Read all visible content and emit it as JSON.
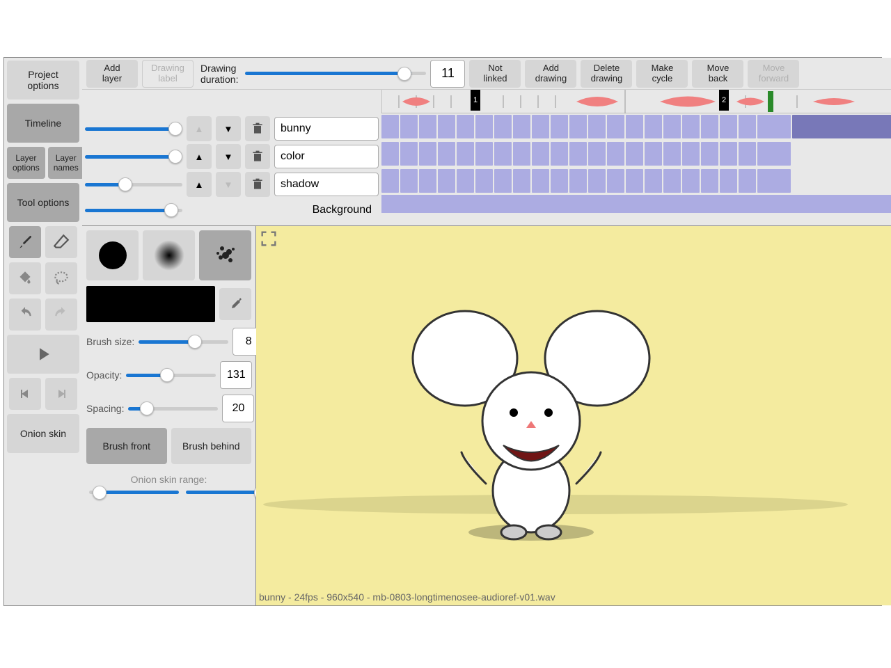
{
  "sidebar": {
    "project_options": "Project\noptions",
    "timeline": "Timeline",
    "layer_options": "Layer\noptions",
    "layer_names": "Layer\nnames",
    "tool_options": "Tool options",
    "onion_skin": "Onion skin"
  },
  "topbar": {
    "add_layer": "Add\nlayer",
    "drawing_label": "Drawing\nlabel",
    "duration_label": "Drawing\nduration:",
    "duration_value": "11",
    "not_linked": "Not\nlinked",
    "add_drawing": "Add\ndrawing",
    "delete_drawing": "Delete\ndrawing",
    "make_cycle": "Make\ncycle",
    "move_back": "Move\nback",
    "move_forward": "Move\nforward"
  },
  "layers": {
    "names": [
      "bunny",
      "color",
      "shadow"
    ],
    "background": "Background",
    "markers": [
      "1",
      "2"
    ]
  },
  "tool": {
    "brush_size_label": "Brush size:",
    "brush_size": "8",
    "opacity_label": "Opacity:",
    "opacity": "131",
    "spacing_label": "Spacing:",
    "spacing": "20",
    "brush_front": "Brush front",
    "brush_behind": "Brush behind",
    "onion_range": "Onion skin range:"
  },
  "status": "bunny - 24fps - 960x540 - mb-0803-longtimenosee-audioref-v01.wav",
  "colors": {
    "frame": "#acace2",
    "canvas": "#f4eb9f",
    "accent": "#1976d2"
  }
}
